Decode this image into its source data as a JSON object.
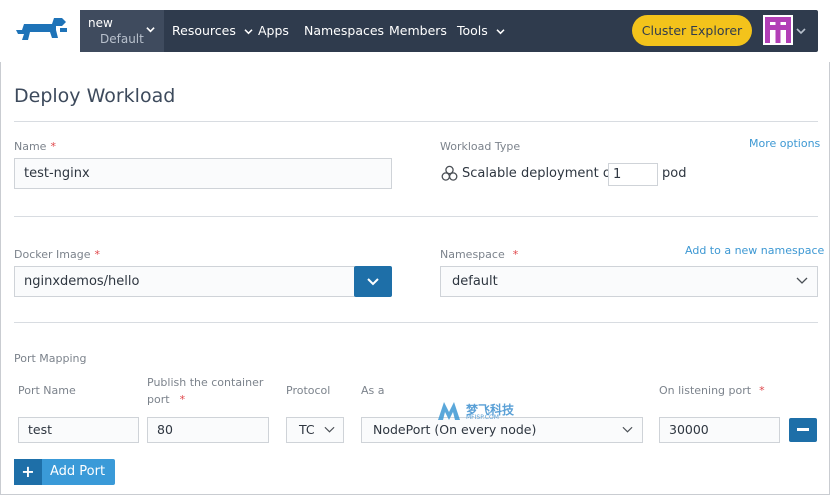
{
  "nav": {
    "cluster_name": "new",
    "project_name": "Default",
    "items": [
      {
        "label": "Resources",
        "has_caret": true
      },
      {
        "label": "Apps",
        "has_caret": false
      },
      {
        "label": "Namespaces",
        "has_caret": false
      },
      {
        "label": "Members",
        "has_caret": false
      },
      {
        "label": "Tools",
        "has_caret": true
      }
    ],
    "cluster_explorer_label": "Cluster Explorer"
  },
  "page": {
    "title": "Deploy Workload"
  },
  "form": {
    "name_label": "Name",
    "name_value": "test-nginx",
    "workload_type_label": "Workload Type",
    "more_options_link": "More options",
    "scalable_prefix": "Scalable deployment of",
    "pod_count": "1",
    "pod_suffix": "pod",
    "docker_image_label": "Docker Image",
    "docker_image_value": "nginxdemos/hello",
    "namespace_label": "Namespace",
    "add_namespace_link": "Add to a new namespace",
    "namespace_value": "default",
    "required_marker": "*"
  },
  "ports": {
    "section_label": "Port Mapping",
    "col_port_name": "Port Name",
    "col_publish_line1": "Publish the container",
    "col_publish_line2": "port",
    "col_protocol": "Protocol",
    "col_as_a": "As a",
    "col_listening": "On listening port",
    "row": {
      "port_name": "test",
      "container_port": "80",
      "protocol": "TC",
      "as_a": "NodePort (On every node)",
      "listening_port": "30000"
    },
    "add_port_plus": "+",
    "add_port_label": "Add Port"
  },
  "watermark": {
    "text": "梦飞科技",
    "sub": "MFISP.COM"
  },
  "colors": {
    "nav_bg": "#2f3b4d",
    "accent_yellow": "#f3c31b",
    "primary_blue": "#1e6fa8",
    "link_blue": "#3d98d3"
  }
}
